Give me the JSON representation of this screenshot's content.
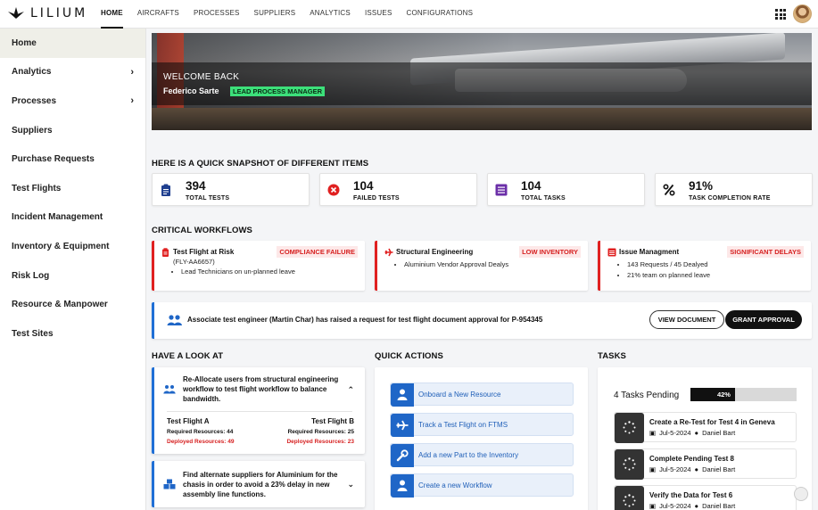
{
  "brand": {
    "name": "LILIUM"
  },
  "nav": [
    "HOME",
    "AIRCRAFTS",
    "PROCESSES",
    "SUPPLIERS",
    "ANALYTICS",
    "ISSUES",
    "CONFIGURATIONS"
  ],
  "sidebar": [
    {
      "label": "Home",
      "active": true
    },
    {
      "label": "Analytics",
      "chevron": true
    },
    {
      "label": "Processes",
      "chevron": true
    },
    {
      "label": "Suppliers"
    },
    {
      "label": "Purchase Requests"
    },
    {
      "label": "Test Flights"
    },
    {
      "label": "Incident Management"
    },
    {
      "label": "Inventory & Equipment"
    },
    {
      "label": "Risk Log"
    },
    {
      "label": "Resource & Manpower"
    },
    {
      "label": "Test Sites"
    }
  ],
  "hero": {
    "welcome": "WELCOME BACK",
    "name": "Federico Sarte",
    "role": "LEAD PROCESS MANAGER"
  },
  "snapshot": {
    "title": "HERE IS A QUICK SNAPSHOT OF DIFFERENT ITEMS",
    "stats": [
      {
        "value": "394",
        "label": "TOTAL TESTS",
        "icon": "clipboard-icon"
      },
      {
        "value": "104",
        "label": "FAILED TESTS",
        "icon": "x-circle-icon"
      },
      {
        "value": "104",
        "label": "TOTAL TASKS",
        "icon": "list-icon"
      },
      {
        "value": "91%",
        "label": "TASK COMPLETION RATE",
        "icon": "percent-icon"
      }
    ]
  },
  "critical": {
    "title": "CRITICAL WORKFLOWS",
    "cards": [
      {
        "title": "Test Flight at Risk",
        "sub": "(FLY-AA6657)",
        "tag": "COMPLIANCE FAILURE",
        "bullets": [
          "Lead Technicians on un-planned leave"
        ]
      },
      {
        "title": "Structural Engineering",
        "tag": "LOW INVENTORY",
        "bullets": [
          "Aluminium Vendor Approval Dealys"
        ]
      },
      {
        "title": "Issue Managment",
        "tag": "SIGNIFICANT DELAYS",
        "bullets": [
          "143 Requests / 45 Dealyed",
          "21% team on planned leave"
        ]
      }
    ]
  },
  "notice": {
    "text": "Associate test engineer (Martin Char) has raised a request for test flight document approval for P-954345",
    "view": "VIEW DOCUMENT",
    "grant": "GRANT APPROVAL"
  },
  "look": {
    "title": "HAVE A LOOK AT",
    "cards": [
      {
        "text": "Re-Allocate users from structural engineering workflow to test flight workflow to balance bandwidth.",
        "a": {
          "name": "Test Flight A",
          "req": "Required Resources: 44",
          "dep": "Deployed Resources: 49"
        },
        "b": {
          "name": "Test Flight B",
          "req": "Required Resources: 25",
          "dep": "Deployed Resources: 23"
        }
      },
      {
        "text": "Find alternate suppliers for Aluminium for the chasis in order to avoid a 23% delay in new assembly line functions."
      }
    ]
  },
  "quick": {
    "title": "QUICK ACTIONS",
    "items": [
      {
        "label": "Onboard a New Resource",
        "icon": "person-icon"
      },
      {
        "label": "Track a Test Flight on FTMS",
        "icon": "plane-icon"
      },
      {
        "label": "Add a new Part to the Inventory",
        "icon": "wrench-icon"
      },
      {
        "label": "Create a new Workflow",
        "icon": "person-icon"
      }
    ]
  },
  "tasks": {
    "title": "TASKS",
    "pending": "4 Tasks Pending",
    "progress": "42%",
    "progress_value": 42,
    "items": [
      {
        "title": "Create a Re-Test for Test 4 in Geneva",
        "date": "Jul-5-2024",
        "user": "Daniel Bart"
      },
      {
        "title": "Complete Pending Test 8",
        "date": "Jul-5-2024",
        "user": "Daniel Bart"
      },
      {
        "title": "Verify the Data for Test 6",
        "date": "Jul-5-2024",
        "user": "Daniel Bart"
      }
    ]
  },
  "colors": {
    "accent_blue": "#1f66c7",
    "alert_red": "#e02020",
    "role_green": "#3ce07a"
  }
}
